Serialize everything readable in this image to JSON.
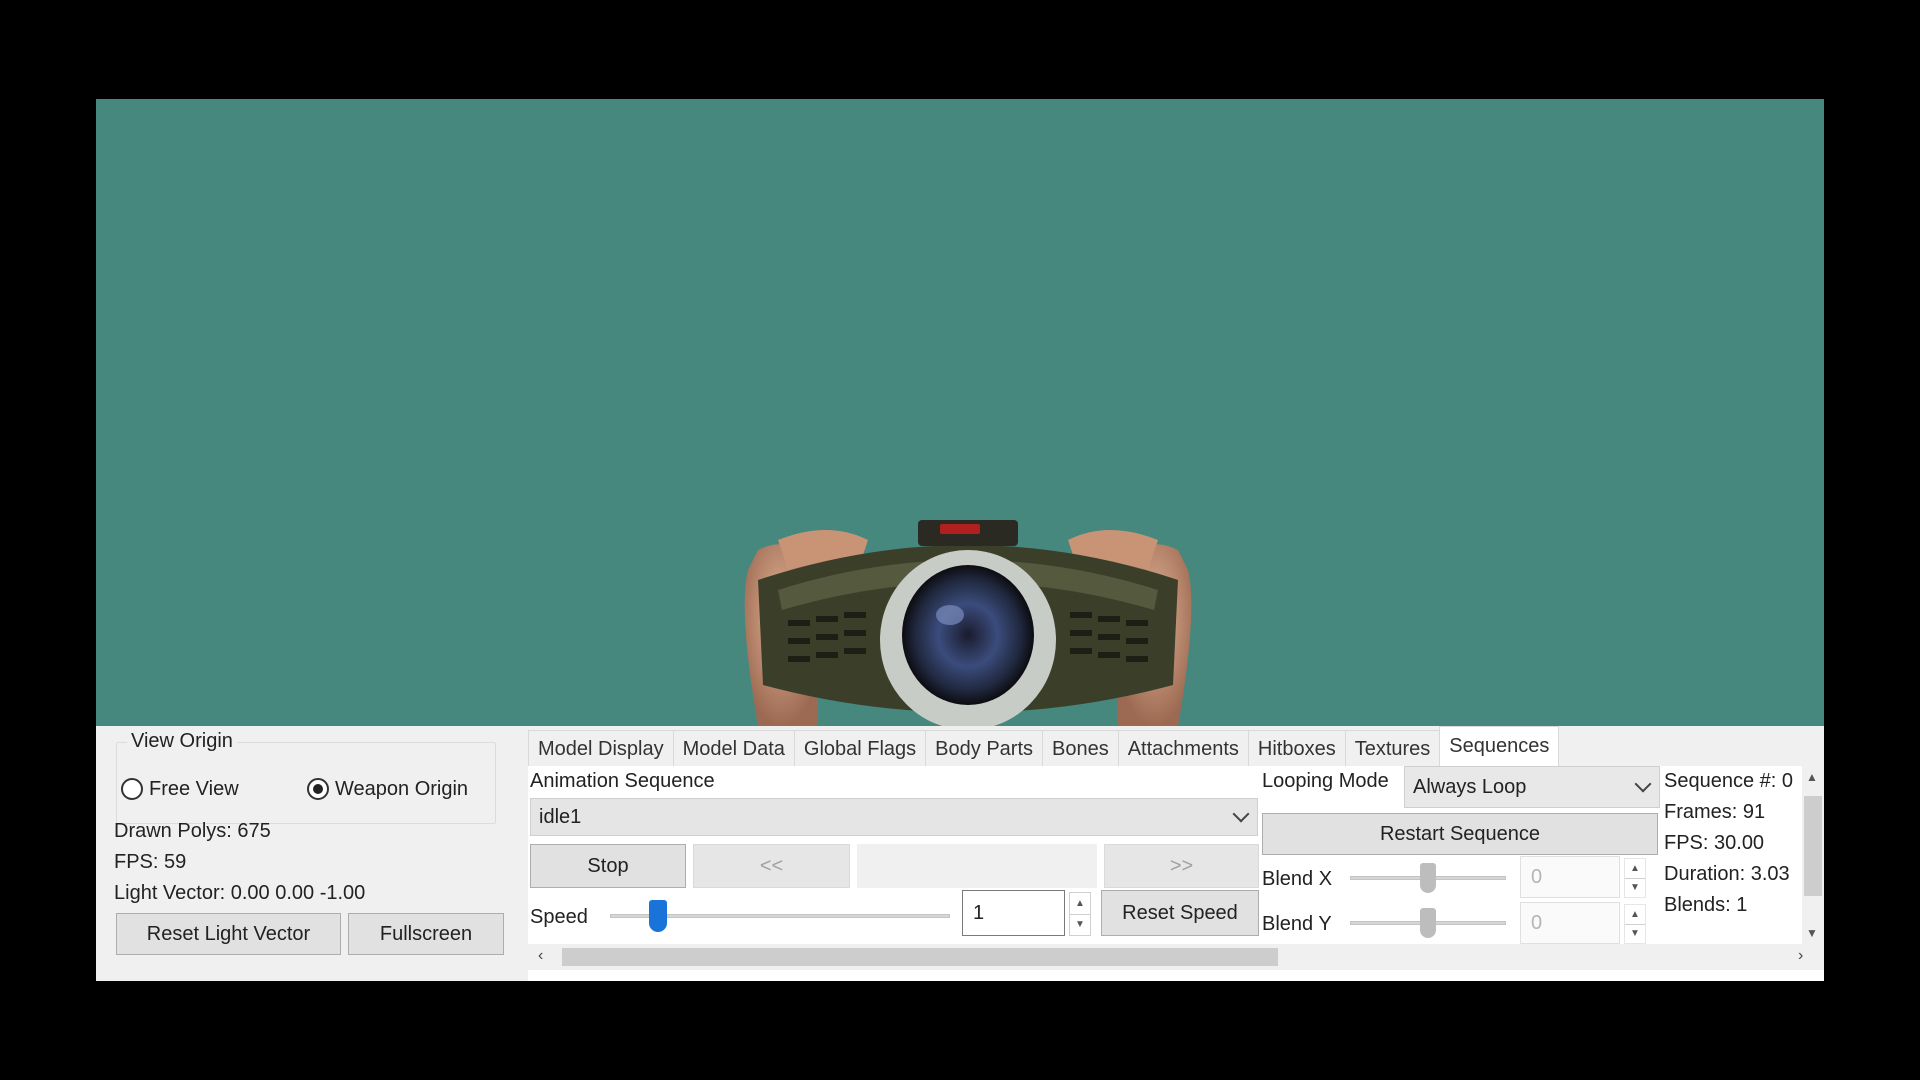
{
  "view_origin": {
    "title": "View Origin",
    "options": [
      "Free View",
      "Weapon Origin"
    ],
    "selected": "Weapon Origin"
  },
  "stats": {
    "drawn_polys": "Drawn Polys: 675",
    "fps": "FPS: 59",
    "light_vector": "Light Vector: 0.00 0.00 -1.00"
  },
  "buttons": {
    "reset_light_vector": "Reset Light Vector",
    "fullscreen": "Fullscreen"
  },
  "tabs": [
    "Model Display",
    "Model Data",
    "Global Flags",
    "Body Parts",
    "Bones",
    "Attachments",
    "Hitboxes",
    "Textures",
    "Sequences"
  ],
  "active_tab": "Sequences",
  "sequences": {
    "animation_label": "Animation Sequence",
    "selected_sequence": "idle1",
    "stop": "Stop",
    "prev": "<<",
    "next": ">>",
    "speed_label": "Speed",
    "speed_value": "1",
    "speed_slider_fraction": 0.12,
    "reset_speed": "Reset Speed",
    "looping_label": "Looping Mode",
    "looping_value": "Always Loop",
    "restart": "Restart Sequence",
    "blend_x_label": "Blend X",
    "blend_y_label": "Blend Y",
    "blend_x_value": "0",
    "blend_y_value": "0"
  },
  "info": {
    "sequence": "Sequence #: 0",
    "frames": "Frames: 91",
    "fps": "FPS: 30.00",
    "duration": "Duration: 3.03",
    "blends": "Blends: 1"
  },
  "colors": {
    "viewport_bg": "#46877e",
    "accent": "#1a73d9"
  }
}
